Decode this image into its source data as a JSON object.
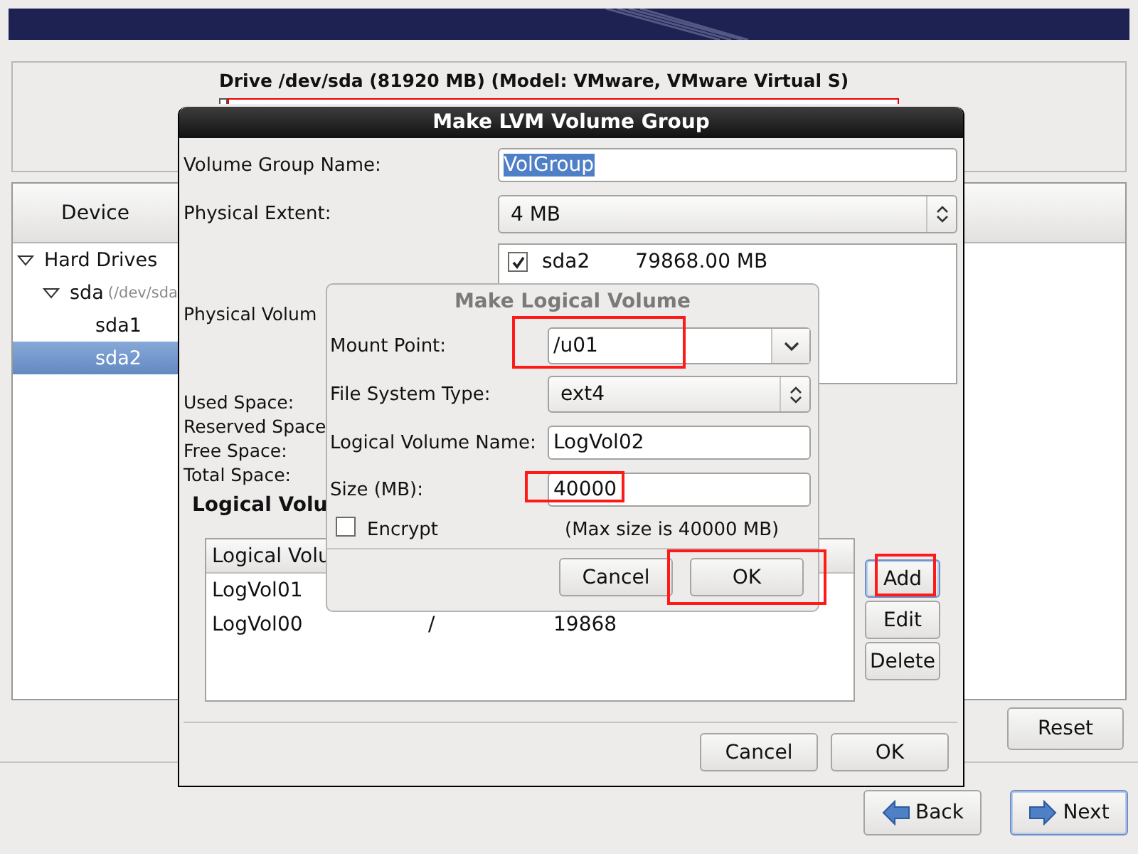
{
  "drive": {
    "title": "Drive /dev/sda (81920 MB) (Model: VMware, VMware Virtual S)"
  },
  "device_panel": {
    "column": "Device",
    "tree": [
      {
        "label": "Hard Drives",
        "expanded": true,
        "children": [
          {
            "label": "sda",
            "detail": "(/dev/sda",
            "expanded": true,
            "children": [
              {
                "label": "sda1",
                "selected": false
              },
              {
                "label": "sda2",
                "selected": true
              }
            ]
          }
        ]
      }
    ]
  },
  "main_buttons": [
    {
      "label": "Reset"
    }
  ],
  "nav_buttons": [
    {
      "label": "Back",
      "focused": false
    },
    {
      "label": "Next",
      "focused": true
    }
  ],
  "lvm_dialog": {
    "title": "Make LVM Volume Group",
    "fields": [
      {
        "kind": "entry",
        "label": "Volume Group Name:",
        "value": "VolGroup",
        "value_selected": true
      },
      {
        "kind": "combo",
        "label": "Physical Extent:",
        "value": "4 MB"
      }
    ],
    "physical_volumes": {
      "label": "Physical Volum",
      "items": [
        {
          "checked": true,
          "name": "sda2",
          "size": "79868.00 MB"
        }
      ]
    },
    "space_labels": [
      "Used Space:",
      "Reserved Space",
      "Free Space:",
      "Total Space:"
    ],
    "logical_volumes": {
      "heading": "Logical Volu",
      "column_1": "Logical Volu",
      "rows": [
        [
          "LogVol01"
        ],
        [
          "LogVol00",
          "/",
          "19868"
        ]
      ]
    },
    "side_buttons": [
      {
        "label": "Add",
        "focused": true
      },
      {
        "label": "Edit",
        "focused": false
      },
      {
        "label": "Delete",
        "focused": false
      }
    ],
    "buttons": [
      "Cancel",
      "OK"
    ]
  },
  "lv_dialog": {
    "title": "Make Logical Volume",
    "fields": [
      {
        "kind": "combo-entry",
        "label": "Mount Point:",
        "value": "/u01"
      },
      {
        "kind": "combo",
        "label": "File System Type:",
        "value": "ext4"
      },
      {
        "kind": "entry",
        "label": "Logical Volume Name:",
        "value": "LogVol02"
      },
      {
        "kind": "entry",
        "label": "Size (MB):",
        "value": "40000"
      }
    ],
    "encrypt": {
      "label": "Encrypt",
      "checked": false
    },
    "max_size": "(Max size is 40000 MB)",
    "buttons": [
      "Cancel",
      "OK"
    ]
  }
}
